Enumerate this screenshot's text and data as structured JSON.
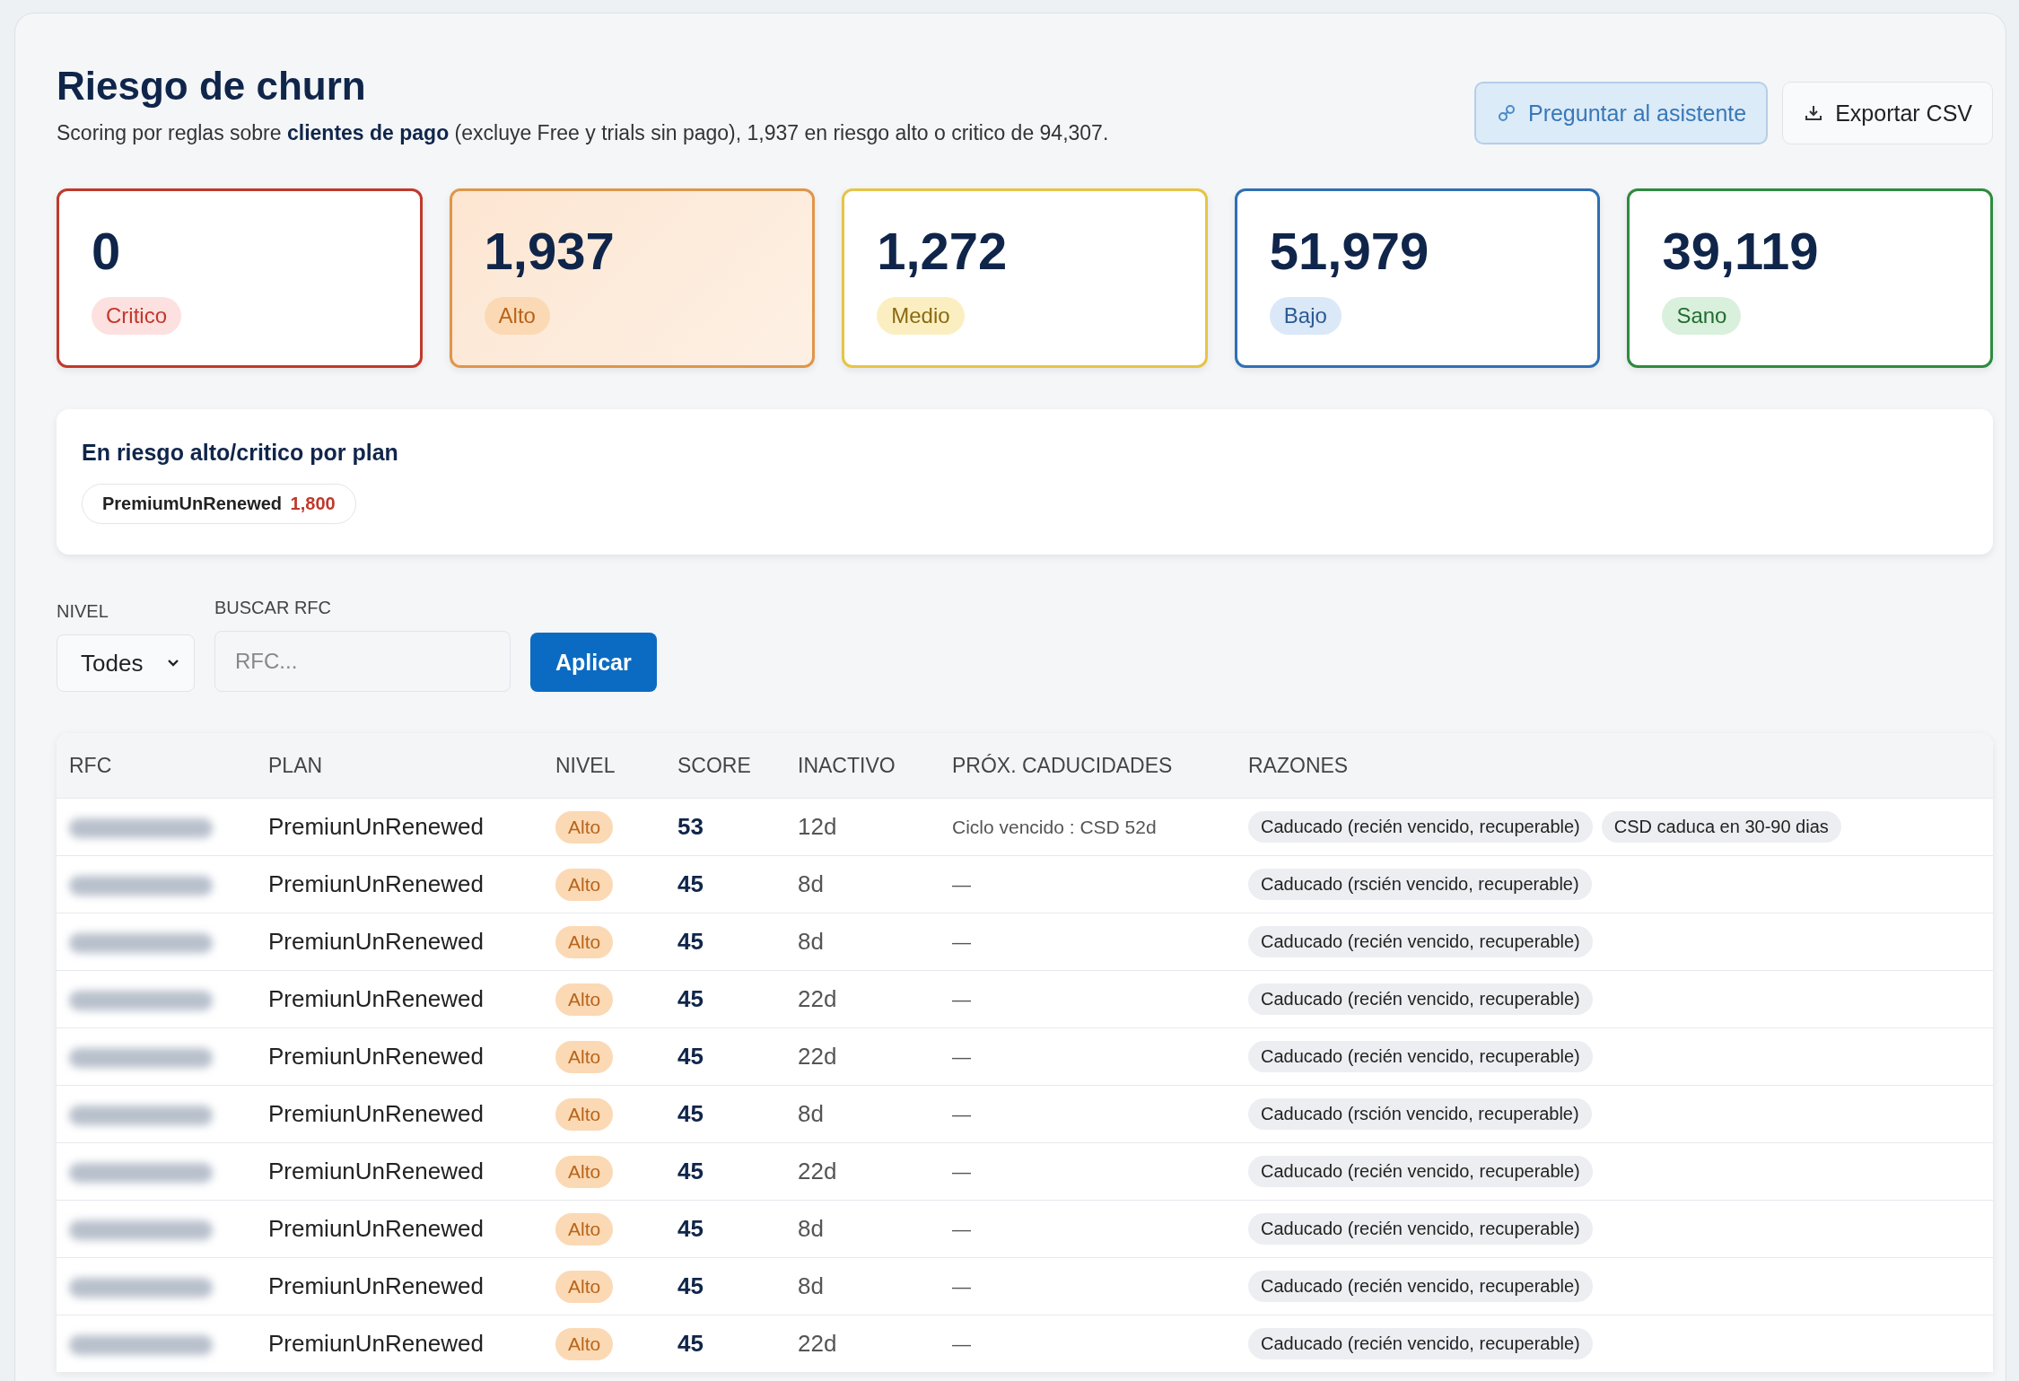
{
  "header": {
    "title": "Riesgo de churn",
    "subtitle": "Scoring por reglas sobre **clientes de pago** (excluye Free y trials sin pago), 1,937 en riesgo alto o critico de 94,307.",
    "buttons": [
      {
        "kind": "assistant",
        "label": "Preguntar al asistente"
      },
      {
        "kind": "export",
        "label": "Exportar CSV"
      }
    ]
  },
  "stats": [
    {
      "kind": "critico",
      "value": "0",
      "label": "Critico",
      "selected": false
    },
    {
      "kind": "alto",
      "value": "1,937",
      "label": "Alto",
      "selected": true
    },
    {
      "kind": "medio",
      "value": "1,272",
      "label": "Medio",
      "selected": false
    },
    {
      "kind": "bajo",
      "value": "51,979",
      "label": "Bajo",
      "selected": false
    },
    {
      "kind": "sano",
      "value": "39,119",
      "label": "Sano",
      "selected": false
    }
  ],
  "by_plan": {
    "title": "En riesgo alto/critico por plan",
    "chips": [
      {
        "plan": "PremiumUnRenewed",
        "count": "1,800"
      }
    ]
  },
  "filters": {
    "level": {
      "label": "NIVEL",
      "value": "Todes"
    },
    "search": {
      "label": "BUSCAR RFC",
      "placeholder": "RFC..."
    },
    "apply": "Aplicar"
  },
  "table": {
    "columns": [
      "RFC",
      "PLAN",
      "NIVEL",
      "SCORE",
      "INACTIVO",
      "PRÓX. CADUCIDADES",
      "RAZONES"
    ],
    "rows": [
      {
        "plan": "PremiunUnRenewed",
        "level": "Alto",
        "kind": "alto",
        "score": "53",
        "inactive": "12d",
        "expiry": "Ciclo vencido : CSD 52d",
        "reasons": [
          "Caducado (recién vencido, recuperable)",
          "CSD caduca en 30-90 dias"
        ]
      },
      {
        "plan": "PremiunUnRenewed",
        "level": "Alto",
        "kind": "alto",
        "score": "45",
        "inactive": "8d",
        "expiry": "—",
        "reasons": [
          "Caducado (rscién vencido, recuperable)"
        ]
      },
      {
        "plan": "PremiunUnRenewed",
        "level": "Alto",
        "kind": "alto",
        "score": "45",
        "inactive": "8d",
        "expiry": "—",
        "reasons": [
          "Caducado (recién vencido, recuperable)"
        ]
      },
      {
        "plan": "PremiunUnRenewed",
        "level": "Alto",
        "kind": "alto",
        "score": "45",
        "inactive": "22d",
        "expiry": "—",
        "reasons": [
          "Caducado (recién vencido, recuperable)"
        ]
      },
      {
        "plan": "PremiunUnRenewed",
        "level": "Alto",
        "kind": "alto",
        "score": "45",
        "inactive": "22d",
        "expiry": "—",
        "reasons": [
          "Caducado (recién vencido, recuperable)"
        ]
      },
      {
        "plan": "PremiunUnRenewed",
        "level": "Alto",
        "kind": "alto",
        "score": "45",
        "inactive": "8d",
        "expiry": "—",
        "reasons": [
          "Caducado (rsción vencido, recuperable)"
        ]
      },
      {
        "plan": "PremiunUnRenewed",
        "level": "Alto",
        "kind": "alto",
        "score": "45",
        "inactive": "22d",
        "expiry": "—",
        "reasons": [
          "Caducado (recién vencido, recuperable)"
        ]
      },
      {
        "plan": "PremiunUnRenewed",
        "level": "Alto",
        "kind": "alto",
        "score": "45",
        "inactive": "8d",
        "expiry": "—",
        "reasons": [
          "Caducado (recién vencido, recuperable)"
        ]
      },
      {
        "plan": "PremiunUnRenewed",
        "level": "Alto",
        "kind": "alto",
        "score": "45",
        "inactive": "8d",
        "expiry": "—",
        "reasons": [
          "Caducado (recién vencido, recuperable)"
        ]
      },
      {
        "plan": "PremiunUnRenewed",
        "level": "Alto",
        "kind": "alto",
        "score": "45",
        "inactive": "22d",
        "expiry": "—",
        "reasons": [
          "Caducado (recién vencido, recuperable)"
        ]
      }
    ]
  }
}
